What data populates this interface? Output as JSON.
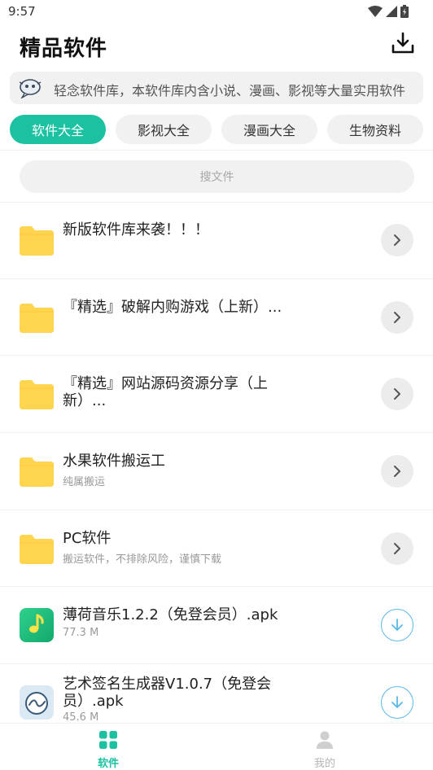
{
  "status_bar": {
    "time": "9:57"
  },
  "header": {
    "title": "精品软件"
  },
  "notice": {
    "text": "轻念软件库，本软件库内含小说、漫画、影视等大量实用软件"
  },
  "tabs": [
    {
      "label": "软件大全",
      "active": true
    },
    {
      "label": "影视大全",
      "active": false
    },
    {
      "label": "漫画大全",
      "active": false
    },
    {
      "label": "生物资料",
      "active": false
    }
  ],
  "search": {
    "placeholder": "搜文件"
  },
  "files": [
    {
      "title": "新版软件库来袭！！！",
      "subtitle": "",
      "type": "folder",
      "action": "open"
    },
    {
      "title": "『精选』破解内购游戏（上新）...",
      "subtitle": "",
      "type": "folder",
      "action": "open"
    },
    {
      "title": "『精选』网站源码资源分享（上新）...",
      "subtitle": "",
      "type": "folder",
      "action": "open"
    },
    {
      "title": "水果软件搬运工",
      "subtitle": "纯属搬运",
      "type": "folder",
      "action": "open"
    },
    {
      "title": "PC软件",
      "subtitle": "搬运软件，不排除风险，谨慎下载",
      "type": "folder",
      "action": "open"
    },
    {
      "title": "薄荷音乐1.2.2（免登会员）.apk",
      "subtitle": "77.3 M",
      "type": "apk-music",
      "action": "download"
    },
    {
      "title": "艺术签名生成器V1.0.7（免登会员）.apk",
      "subtitle": "45.6 M",
      "type": "apk-sign",
      "action": "download"
    }
  ],
  "bottom_nav": [
    {
      "label": "软件",
      "active": true
    },
    {
      "label": "我的",
      "active": false
    }
  ],
  "colors": {
    "accent": "#1cc1a2",
    "folder": "#ffd54f",
    "download": "#5ab8e8"
  }
}
